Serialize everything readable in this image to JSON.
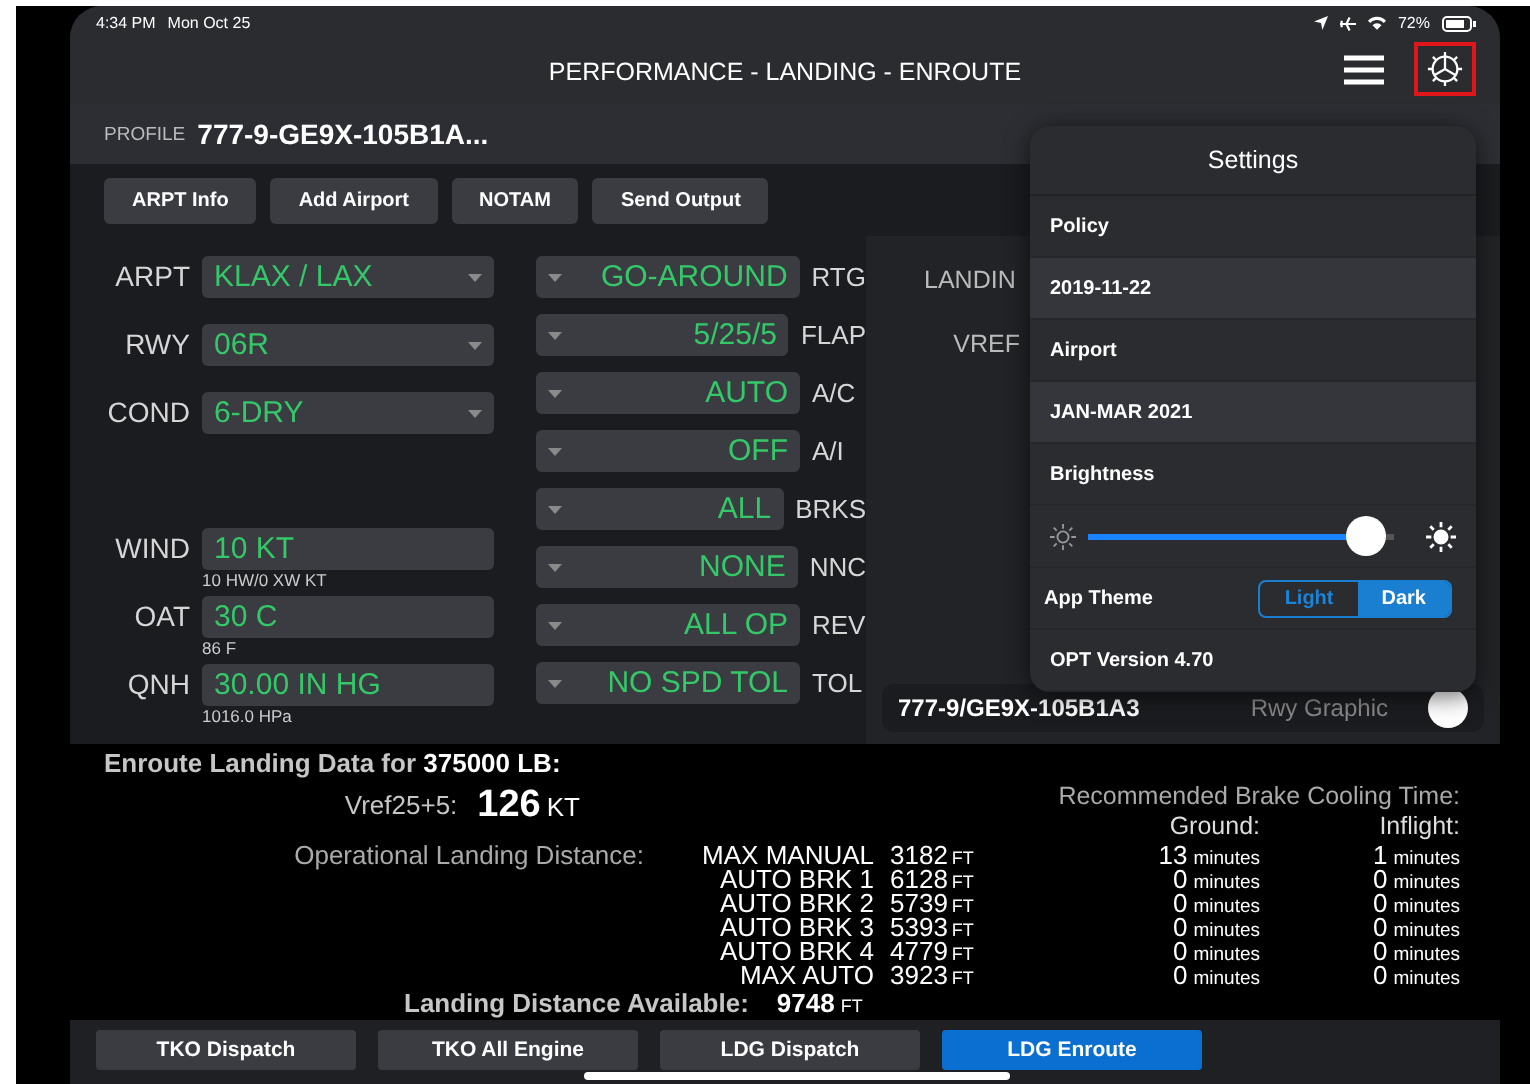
{
  "status_bar": {
    "time": "4:34 PM",
    "date": "Mon Oct 25",
    "battery": "72%"
  },
  "title_bar": {
    "title": "PERFORMANCE - LANDING - ENROUTE"
  },
  "profile": {
    "label": "PROFILE",
    "value": "777-9-GE9X-105B1A..."
  },
  "actions": [
    "ARPT Info",
    "Add Airport",
    "NOTAM",
    "Send Output"
  ],
  "inputs": [
    {
      "kind": "dropdown",
      "label": "ARPT",
      "value": "KLAX / LAX"
    },
    {
      "kind": "dropdown",
      "label": "RWY",
      "value": "06R"
    },
    {
      "kind": "dropdown",
      "label": "COND",
      "value": "6-DRY"
    },
    {
      "kind": "field",
      "label": "WIND",
      "value": "10 KT",
      "note": "10 HW/0 XW KT"
    },
    {
      "kind": "field",
      "label": "OAT",
      "value": "30 C",
      "note": "86 F"
    },
    {
      "kind": "field",
      "label": "QNH",
      "value": "30.00 IN HG",
      "note": "1016.0 HPa"
    }
  ],
  "options": [
    {
      "value": "GO-AROUND",
      "label": "RTG"
    },
    {
      "value": "5/25/5",
      "label": "FLAP"
    },
    {
      "value": "AUTO",
      "label": "A/C"
    },
    {
      "value": "OFF",
      "label": "A/I"
    },
    {
      "value": "ALL",
      "label": "BRKS"
    },
    {
      "value": "NONE",
      "label": "NNC"
    },
    {
      "value": "ALL OP",
      "label": "REV"
    },
    {
      "value": "NO SPD TOL",
      "label": "TOL"
    }
  ],
  "results_panel": {
    "labels": [
      "LANDIN",
      "VREF"
    ],
    "profile": "777-9/GE9X-105B1A3",
    "graphic_label": "Rwy Graphic"
  },
  "settings": {
    "title": "Settings",
    "rows": [
      {
        "kind": "header",
        "text": "Policy"
      },
      {
        "kind": "value",
        "text": "2019-11-22"
      },
      {
        "kind": "header",
        "text": "Airport"
      },
      {
        "kind": "value",
        "text": "JAN-MAR 2021"
      },
      {
        "kind": "header",
        "text": "Brightness"
      },
      {
        "kind": "slider",
        "level": 0.97
      },
      {
        "kind": "theme",
        "label": "App Theme",
        "options": [
          {
            "label": "Light",
            "selected": false
          },
          {
            "label": "Dark",
            "selected": true
          }
        ]
      },
      {
        "kind": "header",
        "text": "OPT Version 4.70"
      }
    ]
  },
  "landing_data": {
    "title": "Enroute Landing Data for **375000 LB:**",
    "vref_label": "Vref25+5:",
    "vref_value": "126",
    "vref_unit": "KT",
    "distance_label": "Operational Landing Distance:",
    "cooling_title": "Recommended Brake Cooling Time:",
    "ground_header": "Ground:",
    "inflight_header": "Inflight:",
    "rows": [
      {
        "mode": "MAX MANUAL",
        "distance": "3182",
        "distance_unit": "FT",
        "ground": "13",
        "ground_unit": "minutes",
        "inflight": "1",
        "inflight_unit": "minutes"
      },
      {
        "mode": "AUTO BRK 1",
        "distance": "6128",
        "distance_unit": "FT",
        "ground": "0",
        "ground_unit": "minutes",
        "inflight": "0",
        "inflight_unit": "minutes"
      },
      {
        "mode": "AUTO BRK 2",
        "distance": "5739",
        "distance_unit": "FT",
        "ground": "0",
        "ground_unit": "minutes",
        "inflight": "0",
        "inflight_unit": "minutes"
      },
      {
        "mode": "AUTO BRK 3",
        "distance": "5393",
        "distance_unit": "FT",
        "ground": "0",
        "ground_unit": "minutes",
        "inflight": "0",
        "inflight_unit": "minutes"
      },
      {
        "mode": "AUTO BRK 4",
        "distance": "4779",
        "distance_unit": "FT",
        "ground": "0",
        "ground_unit": "minutes",
        "inflight": "0",
        "inflight_unit": "minutes"
      },
      {
        "mode": "MAX AUTO",
        "distance": "3923",
        "distance_unit": "FT",
        "ground": "0",
        "ground_unit": "minutes",
        "inflight": "0",
        "inflight_unit": "minutes"
      }
    ],
    "available_label": "Landing Distance Available:",
    "available_value": "9748",
    "available_unit": "FT"
  },
  "tabs": [
    {
      "label": "TKO Dispatch",
      "selected": false
    },
    {
      "label": "TKO All Engine",
      "selected": false
    },
    {
      "label": "LDG Dispatch",
      "selected": false
    },
    {
      "label": "LDG Enroute",
      "selected": true
    }
  ]
}
